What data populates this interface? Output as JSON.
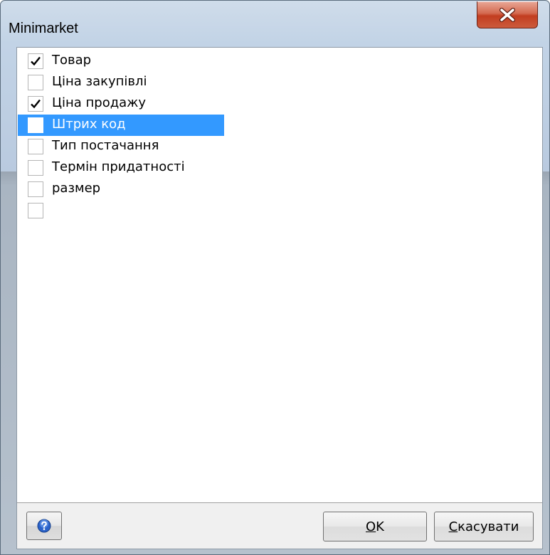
{
  "window": {
    "title": "Minimarket"
  },
  "icons": {
    "close": "close-icon",
    "check": "check-icon",
    "help": "help-icon"
  },
  "colors": {
    "selection": "#3399ff",
    "close_button": "#c94a2e",
    "window_frame": "#c2d3e6"
  },
  "list": {
    "items": [
      {
        "label": "Товар",
        "checked": true,
        "selected": false
      },
      {
        "label": "Ціна закупівлі",
        "checked": false,
        "selected": false
      },
      {
        "label": "Ціна продажу",
        "checked": true,
        "selected": false
      },
      {
        "label": "Штрих код",
        "checked": false,
        "selected": true
      },
      {
        "label": "Тип постачання",
        "checked": false,
        "selected": false
      },
      {
        "label": "Термін придатності",
        "checked": false,
        "selected": false
      },
      {
        "label": "размер",
        "checked": false,
        "selected": false
      },
      {
        "label": "",
        "checked": false,
        "selected": false
      }
    ]
  },
  "footer": {
    "ok_mnemonic": "O",
    "ok_rest": "K",
    "cancel_mnemonic": "С",
    "cancel_rest": "касувати"
  }
}
